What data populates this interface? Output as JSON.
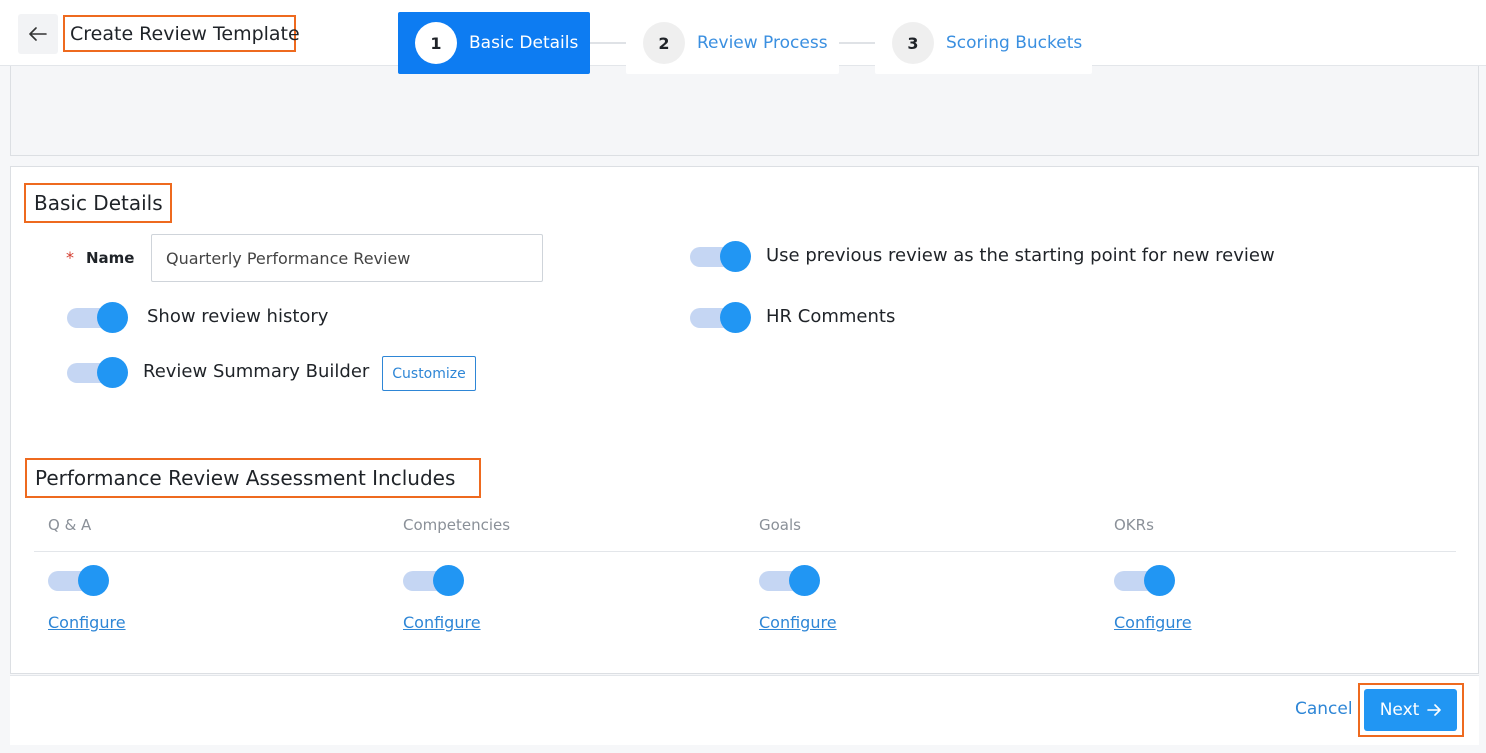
{
  "header": {
    "title": "Create Review Template",
    "back_icon": "arrow-left-icon"
  },
  "stepper": {
    "steps": [
      {
        "number": "1",
        "label": "Basic Details",
        "active": true
      },
      {
        "number": "2",
        "label": "Review Process",
        "active": false
      },
      {
        "number": "3",
        "label": "Scoring Buckets",
        "active": false
      }
    ]
  },
  "basic_details": {
    "heading": "Basic Details",
    "name_label": "Name",
    "name_required_mark": "*",
    "name_value": "Quarterly Performance Review",
    "use_previous_label": "Use previous review as the starting point for new review",
    "show_history_label": "Show review history",
    "hr_comments_label": "HR Comments",
    "summary_builder_label": "Review Summary Builder",
    "customize_label": "Customize",
    "toggles_on": {
      "use_previous": true,
      "show_history": true,
      "hr_comments": true,
      "summary_builder": true
    }
  },
  "assessment": {
    "heading": "Performance Review Assessment Includes",
    "columns": [
      {
        "label": "Q & A",
        "enabled": true,
        "link": "Configure"
      },
      {
        "label": "Competencies",
        "enabled": true,
        "link": "Configure"
      },
      {
        "label": "Goals",
        "enabled": true,
        "link": "Configure"
      },
      {
        "label": "OKRs",
        "enabled": true,
        "link": "Configure"
      }
    ]
  },
  "footer": {
    "cancel_label": "Cancel",
    "next_label": "Next",
    "next_icon": "arrow-right-icon"
  },
  "colors": {
    "primary": "#2196f3",
    "active_step": "#0d7cf2",
    "highlight": "#ee6a1f",
    "link": "#2e86d6"
  }
}
